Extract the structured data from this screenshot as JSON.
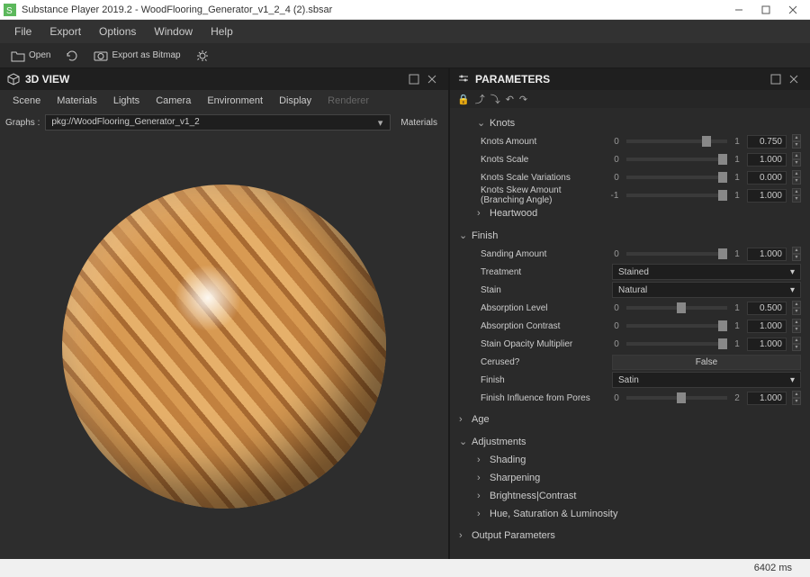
{
  "titlebar": {
    "text": "Substance Player 2019.2 - WoodFlooring_Generator_v1_2_4 (2).sbsar"
  },
  "menubar": [
    "File",
    "Export",
    "Options",
    "Window",
    "Help"
  ],
  "toolbar": {
    "open": "Open",
    "export_bitmap": "Export as Bitmap"
  },
  "panel3d": {
    "title": "3D VIEW",
    "tabs": [
      "Scene",
      "Materials",
      "Lights",
      "Camera",
      "Environment",
      "Display",
      "Renderer"
    ],
    "graphs_label": "Graphs :",
    "graphs_value": "pkg://WoodFlooring_Generator_v1_2",
    "materials_btn": "Materials"
  },
  "params": {
    "title": "PARAMETERS",
    "groups": {
      "knots": {
        "label": "Knots",
        "rows": [
          {
            "label": "Knots Amount",
            "min": "0",
            "max": "1",
            "value": "0.750",
            "thumb": 0.75
          },
          {
            "label": "Knots Scale",
            "min": "0",
            "max": "1",
            "value": "1.000",
            "thumb": 1.0
          },
          {
            "label": "Knots Scale Variations",
            "min": "0",
            "max": "1",
            "value": "0.000",
            "thumb": 1.0
          },
          {
            "label": "Knots Skew Amount (Branching Angle)",
            "min": "-1",
            "max": "1",
            "value": "1.000",
            "thumb": 1.0
          }
        ]
      },
      "heartwood": {
        "label": "Heartwood"
      },
      "finish": {
        "label": "Finish",
        "sanding": {
          "label": "Sanding Amount",
          "min": "0",
          "max": "1",
          "value": "1.000",
          "thumb": 1.0
        },
        "treatment": {
          "label": "Treatment",
          "value": "Stained"
        },
        "stain": {
          "label": "Stain",
          "value": "Natural"
        },
        "absorption_level": {
          "label": "Absorption Level",
          "min": "0",
          "max": "1",
          "value": "0.500",
          "thumb": 0.5
        },
        "absorption_contrast": {
          "label": "Absorption Contrast",
          "min": "0",
          "max": "1",
          "value": "1.000",
          "thumb": 1.0
        },
        "stain_opacity": {
          "label": "Stain Opacity Multiplier",
          "min": "0",
          "max": "1",
          "value": "1.000",
          "thumb": 1.0
        },
        "cerused": {
          "label": "Cerused?",
          "value": "False"
        },
        "finish_dd": {
          "label": "Finish",
          "value": "Satin"
        },
        "finish_pores": {
          "label": "Finish Influence from Pores",
          "min": "0",
          "max": "2",
          "value": "1.000",
          "thumb": 0.5
        }
      },
      "age": {
        "label": "Age"
      },
      "adjustments": {
        "label": "Adjustments",
        "subs": [
          "Shading",
          "Sharpening",
          "Brightness|Contrast",
          "Hue, Saturation & Luminosity"
        ]
      },
      "output": {
        "label": "Output Parameters"
      }
    }
  },
  "statusbar": {
    "time": "6402 ms"
  }
}
